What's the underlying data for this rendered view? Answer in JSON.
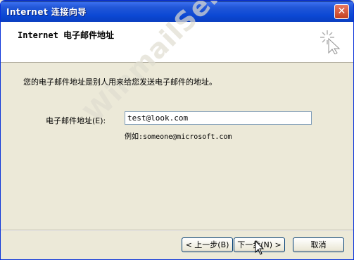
{
  "window": {
    "title": "Internet 连接向导",
    "close_symbol": "✕"
  },
  "header": {
    "title": "Internet 电子邮件地址",
    "icon": "wizard-sparkle-icon"
  },
  "body": {
    "description": "您的电子邮件地址是别人用来给您发送电子邮件的地址。",
    "email_label": "电子邮件地址(E):",
    "email_value": "test@look.com",
    "example": "例如:someone@microsoft.com"
  },
  "watermark": "WinmailServer",
  "buttons": {
    "back": "< 上一步(B)",
    "next": "下一步(N) >",
    "cancel": "取消"
  },
  "colors": {
    "titlebar": "#0b48d4",
    "dialog_bg": "#ece9d8",
    "header_bg": "#ffffff"
  }
}
